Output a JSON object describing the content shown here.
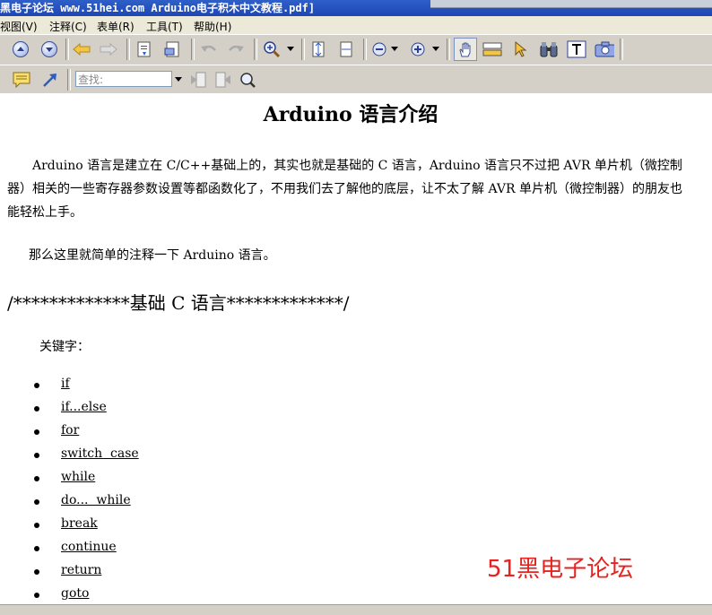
{
  "window": {
    "title": "黑电子论坛 www.51hei.com Arduino电子积木中文教程.pdf]"
  },
  "menu": [
    {
      "label": "视图(V)"
    },
    {
      "label": "注释(C)"
    },
    {
      "label": "表单(R)"
    },
    {
      "label": "工具(T)"
    },
    {
      "label": "帮助(H)"
    }
  ],
  "toolbar": {
    "search_placeholder": "查找:",
    "icons": [
      "scroll-up",
      "scroll-down",
      "back",
      "forward",
      "save",
      "print",
      "undo",
      "redo",
      "zoom",
      "fit-page",
      "fit-width",
      "zoom-out",
      "zoom-in",
      "hand",
      "select-text",
      "pointer",
      "find",
      "text-select",
      "snapshot",
      "comment",
      "arrow",
      "find-dropdown",
      "prev-result",
      "next-result",
      "search"
    ]
  },
  "document": {
    "title": "Arduino 语言介绍",
    "paragraph1": "Arduino 语言是建立在 C/C++基础上的，其实也就是基础的 C 语言，Arduino 语言只不过把 AVR 单片机（微控制器）相关的一些寄存器参数设置等都函数化了，不用我们去了解他的底层，让不太了解 AVR 单片机（微控制器）的朋友也能轻松上手。",
    "paragraph2": "那么这里就简单的注释一下 Arduino 语言。",
    "section_heading": "/*************基础 C 语言*************/",
    "keyword_label": "关键字：",
    "keywords": [
      "if",
      "if...else",
      "for",
      "switch  case",
      "while",
      "do...  while",
      "break",
      "continue",
      "return",
      "goto"
    ]
  },
  "watermark": "51黑电子论坛",
  "colors": {
    "titlebar": "#1d46b4",
    "toolbar": "#d4d0c8",
    "watermark": "#e8231f"
  }
}
